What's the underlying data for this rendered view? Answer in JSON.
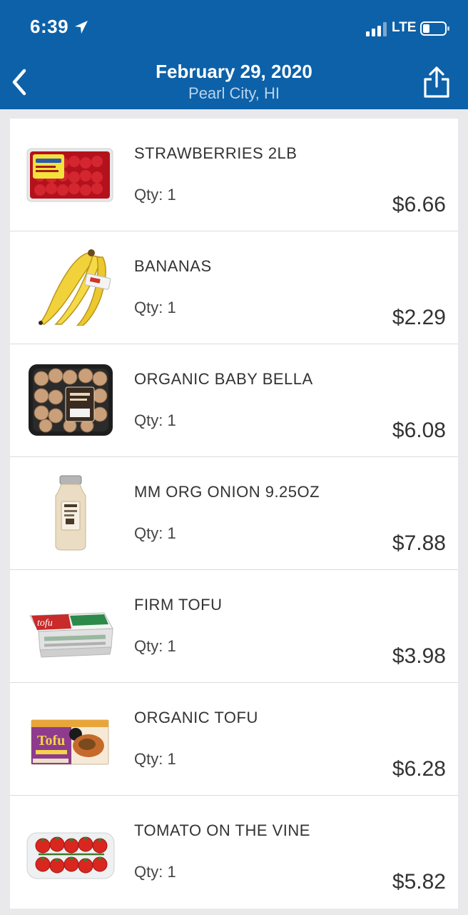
{
  "status_bar": {
    "time": "6:39",
    "carrier": "LTE",
    "icons": [
      "location-arrow-icon",
      "signal-bars-icon",
      "battery-icon"
    ]
  },
  "nav": {
    "title": "February 29, 2020",
    "subtitle": "Pearl City, HI",
    "back_icon": "chevron-left-icon",
    "share_icon": "share-icon",
    "colors": {
      "header_bg": "#0d61a8",
      "subtitle": "#b9d4ee"
    }
  },
  "items": [
    {
      "name": "STRAWBERRIES 2LB",
      "qty": "Qty: 1",
      "price": "$6.66",
      "image": "strawberries"
    },
    {
      "name": "BANANAS",
      "qty": "Qty: 1",
      "price": "$2.29",
      "image": "bananas"
    },
    {
      "name": "ORGANIC BABY BELLA",
      "qty": "Qty: 1",
      "price": "$6.08",
      "image": "mushrooms"
    },
    {
      "name": "MM ORG ONION 9.25OZ",
      "qty": "Qty: 1",
      "price": "$7.88",
      "image": "onion-jar"
    },
    {
      "name": "FIRM TOFU",
      "qty": "Qty: 1",
      "price": "$3.98",
      "image": "tofu-pack"
    },
    {
      "name": "ORGANIC TOFU",
      "qty": "Qty: 1",
      "price": "$6.28",
      "image": "organic-tofu-box"
    },
    {
      "name": "TOMATO ON THE VINE",
      "qty": "Qty: 1",
      "price": "$5.82",
      "image": "tomatoes"
    }
  ]
}
